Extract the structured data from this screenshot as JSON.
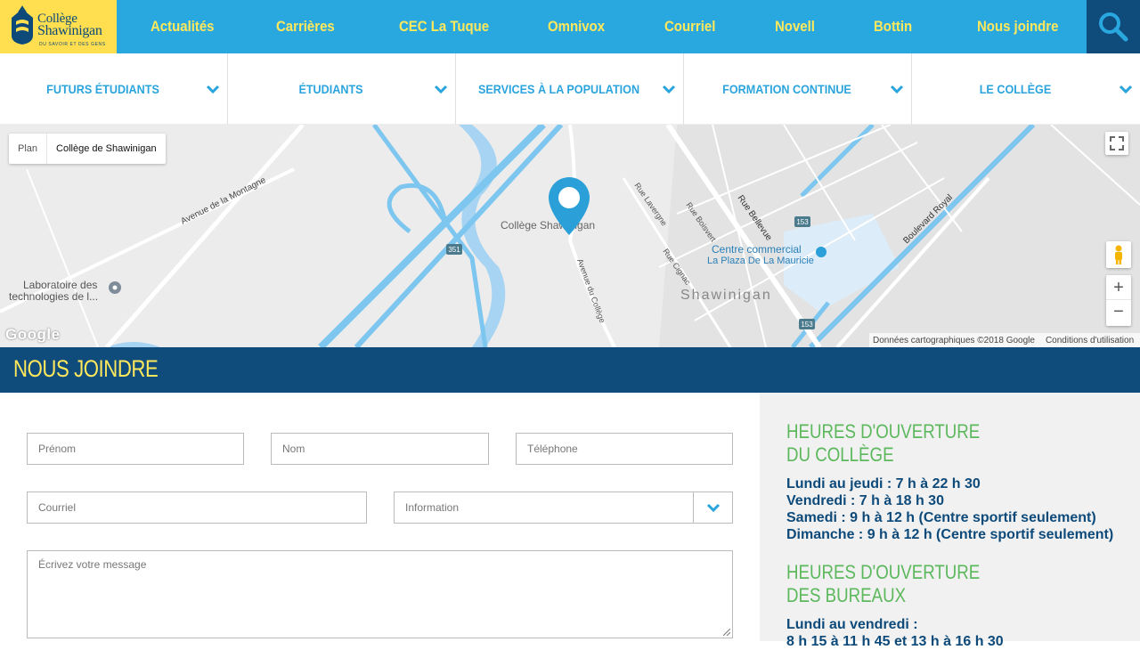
{
  "logo": {
    "line1": "Collège",
    "line2": "Shawinigan",
    "tagline": "DU SAVOIR ET DES GENS"
  },
  "topnav": [
    "Actualités",
    "Carrières",
    "CEC La Tuque",
    "Omnivox",
    "Courriel",
    "Novell",
    "Bottin",
    "Nous joindre"
  ],
  "mainnav": [
    "FUTURS ÉTUDIANTS",
    "ÉTUDIANTS",
    "SERVICES À LA POPULATION",
    "FORMATION CONTINUE",
    "LE COLLÈGE"
  ],
  "map": {
    "tab_plan": "Plan",
    "place_name": "Collège de Shawinigan",
    "pin_label": "Collège Shawinigan",
    "labels": {
      "avenue_montagne": "Avenue de la Montagne",
      "laboratoire": "Laboratoire des",
      "laboratoire2": "technologies de l...",
      "centre": "Centre commercial",
      "plaza": "La Plaza De La Mauricie",
      "shawinigan": "Shawinigan",
      "bellevue": "Rue Bellevue",
      "royal": "Boulevard Royal",
      "avenue_college": "Avenue du Collège",
      "lavergne": "Rue Lavergne",
      "boisvert": "Rue Boisvert",
      "cignac": "Rue Cignac",
      "route351": "351",
      "route153a": "153",
      "route153b": "153"
    },
    "google": "Google",
    "data_credit": "Données cartographiques ©2018 Google",
    "terms": "Conditions d'utilisation"
  },
  "banner": {
    "title": "NOUS JOINDRE"
  },
  "form": {
    "prenom": "Prénom",
    "nom": "Nom",
    "telephone": "Téléphone",
    "courriel": "Courriel",
    "information": "Information",
    "message": "Écrivez votre message"
  },
  "hours": {
    "college_title1": "HEURES D'OUVERTURE",
    "college_title2": "DU COLLÈGE",
    "college_lines": [
      "Lundi au jeudi : 7 h à 22 h 30",
      "Vendredi : 7 h à 18 h 30",
      "Samedi : 9 h à 12 h (Centre sportif seulement)",
      "Dimanche : 9 h à 12 h (Centre sportif seulement)"
    ],
    "offices_title1": "HEURES D'OUVERTURE",
    "offices_title2": "DES BUREAUX",
    "offices_lines": [
      "Lundi au vendredi :",
      "8 h 15 à 11 h 45 et 13 h à 16 h 30"
    ]
  },
  "colors": {
    "nav_blue": "#29a8df",
    "dark_blue": "#0f4c7b",
    "yellow": "#ffe85c",
    "green": "#5cb85c"
  }
}
